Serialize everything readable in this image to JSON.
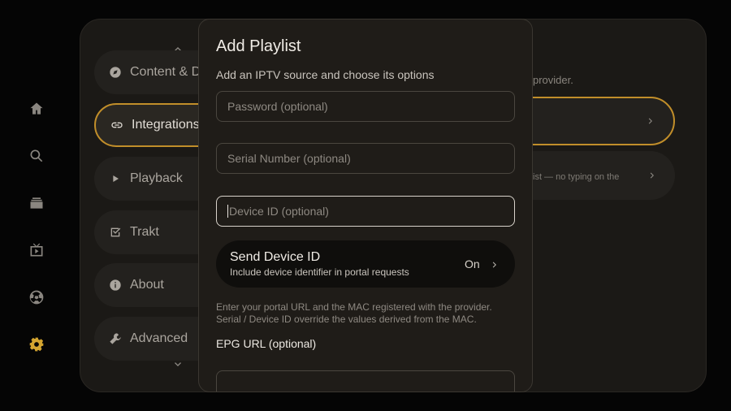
{
  "rail": {
    "items": [
      {
        "icon": "home-icon"
      },
      {
        "icon": "search-icon"
      },
      {
        "icon": "library-icon"
      },
      {
        "icon": "live-tv-icon"
      },
      {
        "icon": "sports-icon"
      },
      {
        "icon": "settings-gear-icon",
        "active": true
      }
    ],
    "active_color": "#d4a530"
  },
  "settings": {
    "menu": [
      {
        "label": "Content & D",
        "icon": "compass-icon"
      },
      {
        "label": "Integrations",
        "icon": "link-icon",
        "selected": true
      },
      {
        "label": "Playback",
        "icon": "play-icon"
      },
      {
        "label": "Trakt",
        "icon": "checkbox-icon"
      },
      {
        "label": "About",
        "icon": "info-icon"
      },
      {
        "label": "Advanced",
        "icon": "wrench-icon"
      }
    ],
    "right_description": "provider.",
    "right_card_2_text": "ist — no typing on the"
  },
  "modal": {
    "title": "Add Playlist",
    "subtitle": "Add an IPTV source and choose its options",
    "fields": {
      "password_placeholder": "Password (optional)",
      "serial_placeholder": "Serial Number (optional)",
      "device_id_placeholder": "Device ID (optional)"
    },
    "send_device_id": {
      "title": "Send Device ID",
      "subtitle": "Include device identifier in portal requests",
      "state": "On"
    },
    "help_line1": "Enter your portal URL and the MAC registered with the provider.",
    "help_line2": "Serial / Device ID override the values derived from the MAC.",
    "epg_label": "EPG URL (optional)"
  },
  "accent_color": "#c18e2a"
}
